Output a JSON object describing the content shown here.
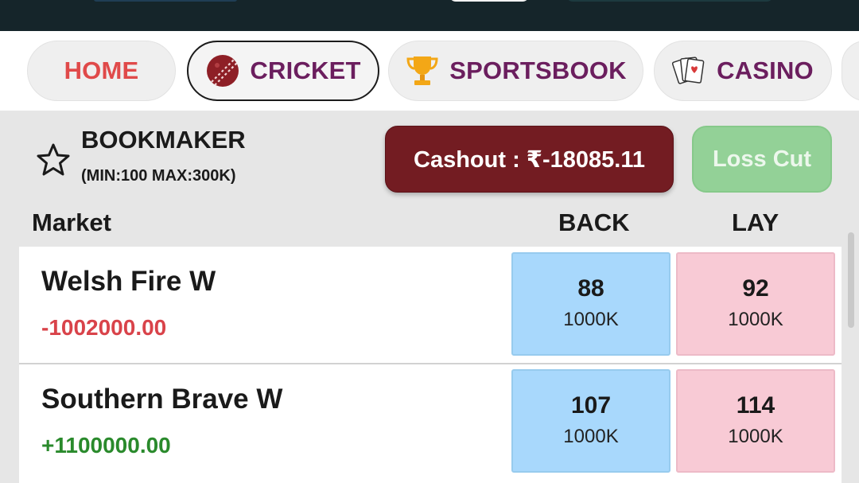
{
  "tabs": [
    {
      "label": "HOME",
      "icon": "",
      "active": false
    },
    {
      "label": "CRICKET",
      "icon": "cricket-ball-icon",
      "active": true
    },
    {
      "label": "SPORTSBOOK",
      "icon": "trophy-icon",
      "active": false
    },
    {
      "label": "CASINO",
      "icon": "playing-cards-icon",
      "active": false
    }
  ],
  "bookmaker": {
    "title": "BOOKMAKER",
    "limits": "(MIN:100 MAX:300K)"
  },
  "actions": {
    "cashout_label": "Cashout : ₹-18085.11",
    "losscut_label": "Loss Cut"
  },
  "columns": {
    "market": "Market",
    "back": "BACK",
    "lay": "LAY"
  },
  "runners": [
    {
      "name": "Welsh Fire W",
      "pl": "-1002000.00",
      "back": {
        "price": "88",
        "size": "1000K"
      },
      "lay": {
        "price": "92",
        "size": "1000K"
      }
    },
    {
      "name": "Southern Brave W",
      "pl": "+1100000.00",
      "back": {
        "price": "107",
        "size": "1000K"
      },
      "lay": {
        "price": "114",
        "size": "1000K"
      }
    }
  ],
  "colors": {
    "topbar": "#15252a",
    "cashout": "#731c22",
    "losscut": "#93d197",
    "back": "#a8d8fc",
    "lay": "#f8cad5",
    "loss": "#d9434a",
    "profit": "#2a8a2c"
  }
}
